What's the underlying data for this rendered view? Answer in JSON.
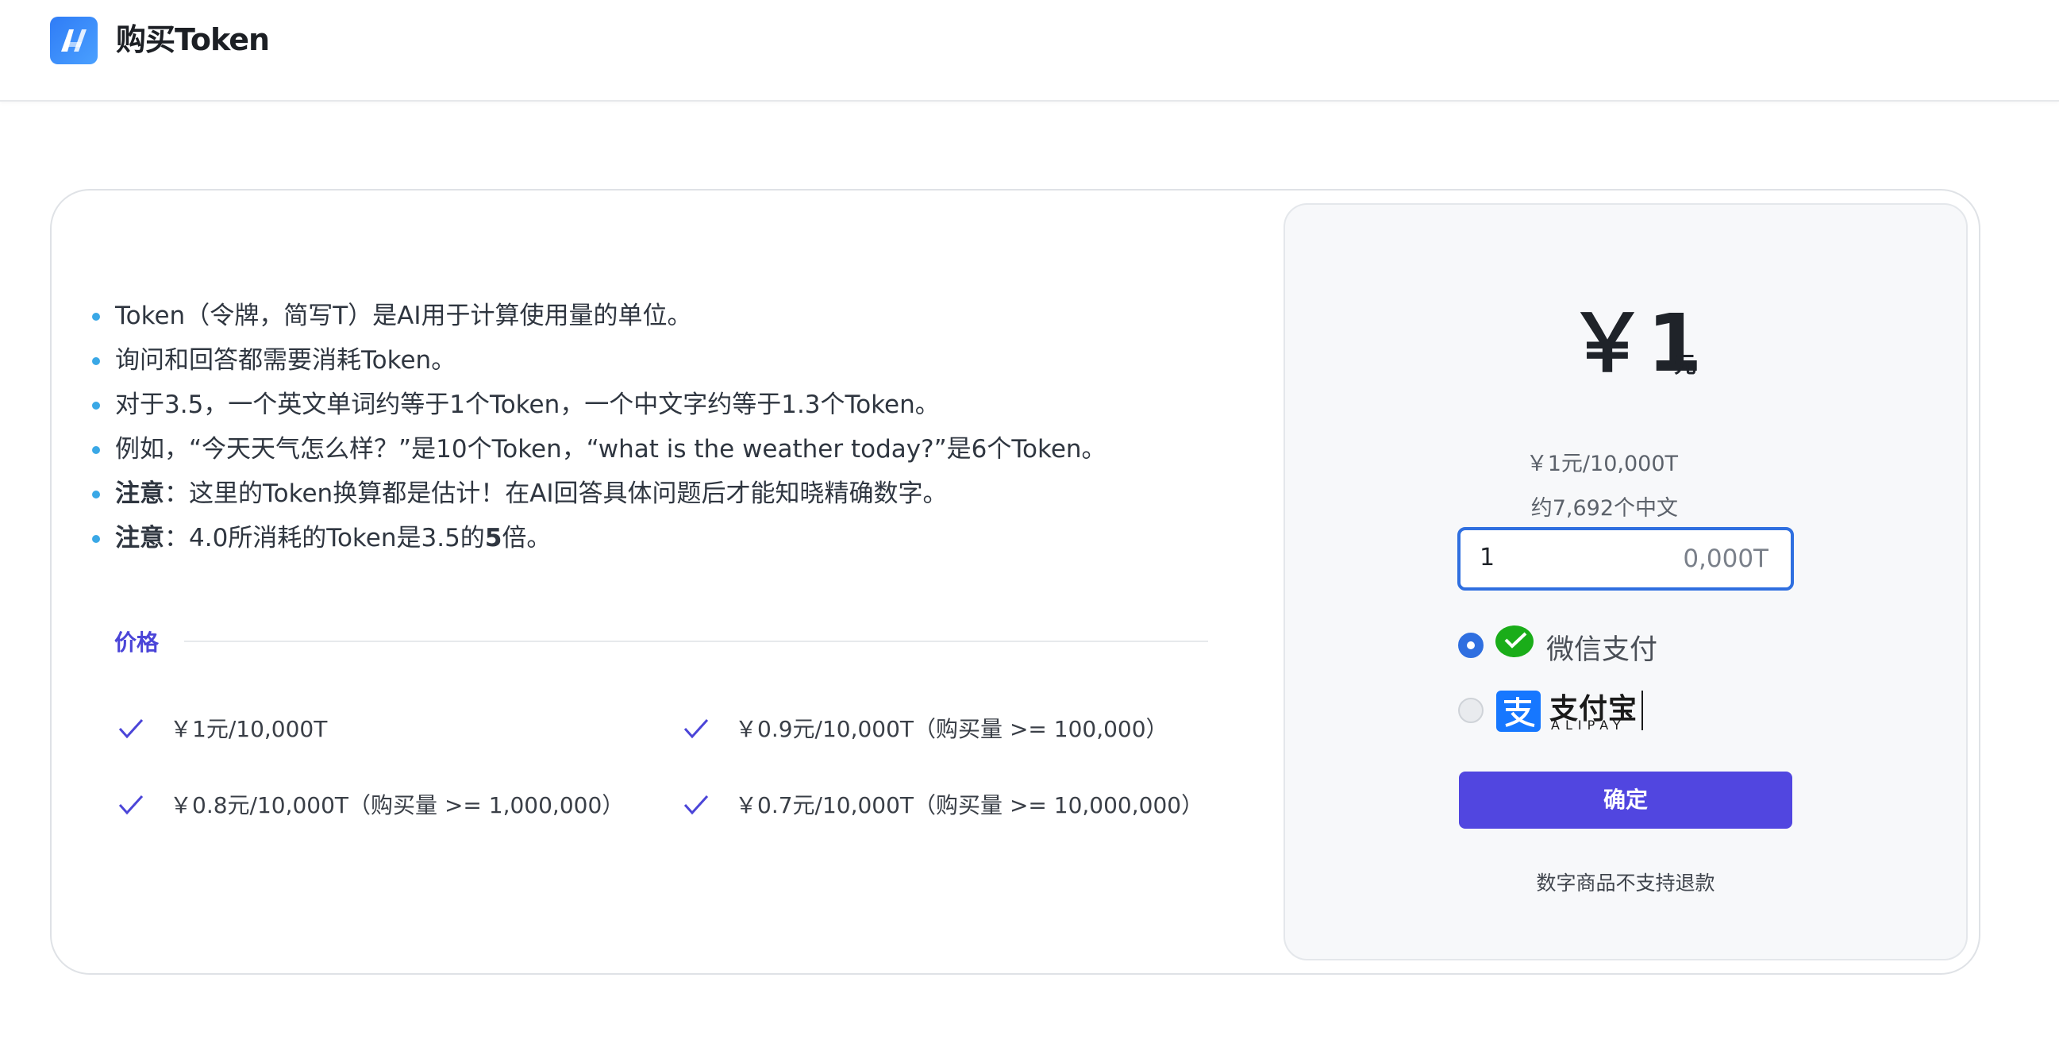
{
  "header": {
    "title": "购买Token",
    "logo_icon": "brand-logo-icon"
  },
  "info": {
    "items": [
      {
        "strong": "",
        "text": "Token（令牌，简写T）是AI用于计算使用量的单位。"
      },
      {
        "strong": "",
        "text": "询问和回答都需要消耗Token。"
      },
      {
        "strong": "",
        "text": "对于3.5，一个英文单词约等于1个Token，一个中文字约等于1.3个Token。"
      },
      {
        "strong": "",
        "text": "例如，“今天天气怎么样？”是10个Token，“what is the weather today?”是6个Token。"
      },
      {
        "strong": "注意",
        "text": "：这里的Token换算都是估计！在AI回答具体问题后才能知晓精确数字。"
      },
      {
        "strong": "注意",
        "text_before": "：4.0所消耗的Token是3.5的",
        "bold_num": "5",
        "text_after": "倍。"
      }
    ]
  },
  "pricing": {
    "label": "价格",
    "tiers": [
      "￥1元/10,000T",
      "￥0.9元/10,000T（购买量 >= 100,000）",
      "￥0.8元/10,000T（购买量 >= 1,000,000）",
      "￥0.7元/10,000T（购买量 >= 10,000,000）"
    ]
  },
  "payment": {
    "amount": "￥1",
    "amount_unit": "元",
    "rate": "￥1元/10,000T",
    "approx": "约7,692个中文",
    "quantity_value": "1",
    "quantity_suffix": "0,000T",
    "methods": [
      {
        "label": "微信支付",
        "icon": "wechat-pay-icon",
        "selected": true
      },
      {
        "label": "支付宝",
        "sublabel": "ALIPAY",
        "icon": "alipay-icon",
        "selected": false
      }
    ],
    "confirm_label": "确定",
    "notice": "数字商品不支持退款"
  },
  "colors": {
    "accent": "#5146e0",
    "focus": "#2f6fe0",
    "bullet": "#3aa8e6",
    "wechat": "#1aad19",
    "alipay": "#1677ff"
  }
}
